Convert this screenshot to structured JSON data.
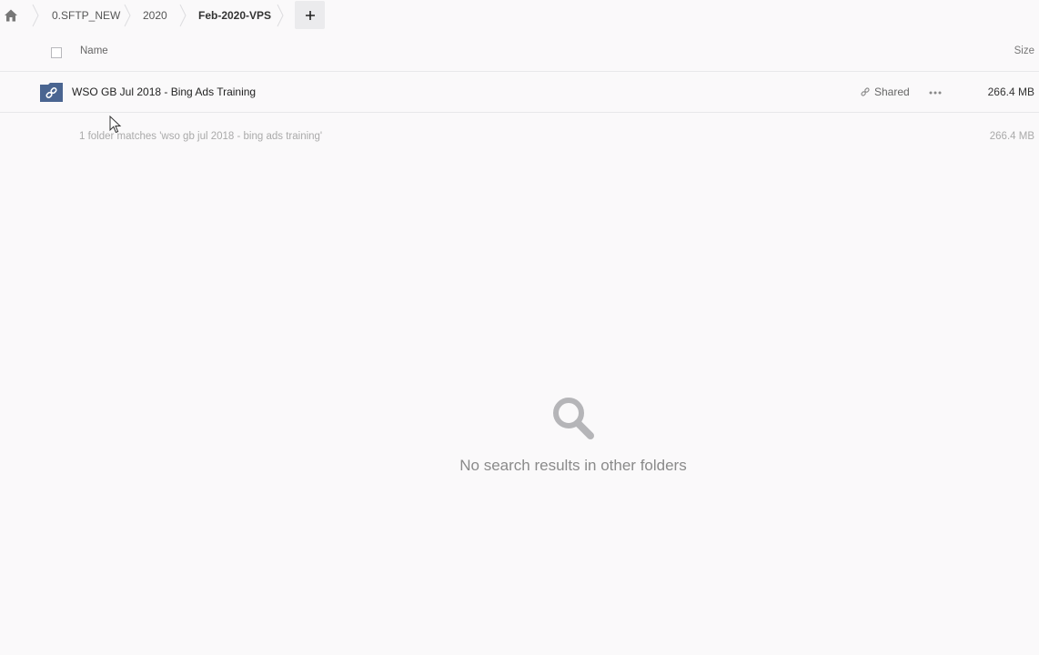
{
  "breadcrumb": {
    "home_icon": "home-icon",
    "items": [
      {
        "label": "0.SFTP_NEW"
      },
      {
        "label": "2020"
      },
      {
        "label": "Feb-2020-VPS"
      }
    ],
    "add_label": "+"
  },
  "table": {
    "columns": {
      "name": "Name",
      "size": "Size"
    },
    "rows": [
      {
        "icon": "shared-folder-icon",
        "name": "WSO GB Jul 2018 - Bing Ads Training",
        "shared_label": "Shared",
        "size": "266.4 MB"
      }
    ]
  },
  "summary": {
    "text": "1 folder matches 'wso gb jul 2018 - bing ads training'",
    "size": "266.4 MB"
  },
  "empty_state": {
    "icon": "search-icon",
    "message": "No search results in other folders"
  },
  "colors": {
    "background": "#faf9fa",
    "folder_icon": "#4a6591",
    "muted_text": "#aaaaaa"
  }
}
